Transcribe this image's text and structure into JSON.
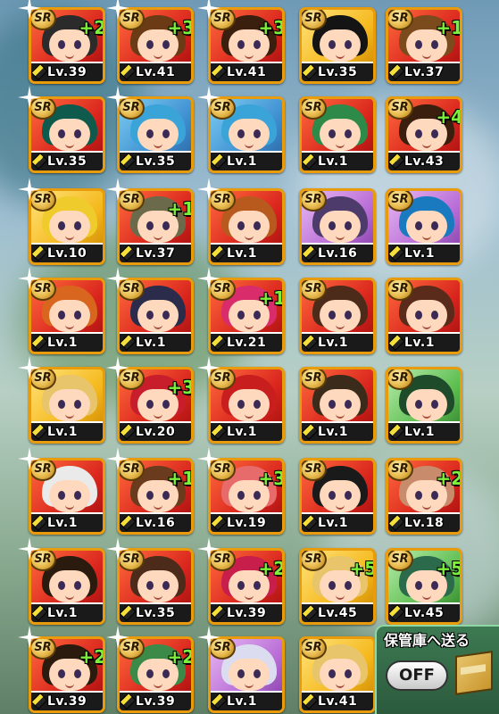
{
  "badge_text": "SR",
  "storage": {
    "label": "保管庫へ送る",
    "toggle": "OFF"
  },
  "cards": [
    {
      "lv": "Lv.39",
      "plus": "+2",
      "bg": "red",
      "hair": "#2b2b2b"
    },
    {
      "lv": "Lv.41",
      "plus": "+3",
      "bg": "red",
      "hair": "#6b3b16"
    },
    {
      "lv": "Lv.41",
      "plus": "+3",
      "bg": "red",
      "hair": "#3b1f0e"
    },
    {
      "lv": "Lv.35",
      "plus": "",
      "bg": "yellow",
      "hair": "#141414"
    },
    {
      "lv": "Lv.37",
      "plus": "+1",
      "bg": "red",
      "hair": "#7b4b1e"
    },
    {
      "lv": "Lv.35",
      "plus": "",
      "bg": "red",
      "hair": "#0e5a4c"
    },
    {
      "lv": "Lv.35",
      "plus": "",
      "bg": "blue",
      "hair": "#3aa4d8"
    },
    {
      "lv": "Lv.1",
      "plus": "",
      "bg": "blue",
      "hair": "#3aa4d8"
    },
    {
      "lv": "Lv.1",
      "plus": "",
      "bg": "red",
      "hair": "#2d8a48"
    },
    {
      "lv": "Lv.43",
      "plus": "+4",
      "bg": "red",
      "hair": "#3b1f0e"
    },
    {
      "lv": "Lv.10",
      "plus": "",
      "bg": "yellow",
      "hair": "#f0cb2c"
    },
    {
      "lv": "Lv.37",
      "plus": "+1",
      "bg": "red",
      "hair": "#6b6b4c"
    },
    {
      "lv": "Lv.1",
      "plus": "",
      "bg": "red",
      "hair": "#b85a1e"
    },
    {
      "lv": "Lv.16",
      "plus": "",
      "bg": "purple",
      "hair": "#4c3b6b"
    },
    {
      "lv": "Lv.1",
      "plus": "",
      "bg": "purple",
      "hair": "#1a7ac0"
    },
    {
      "lv": "Lv.1",
      "plus": "",
      "bg": "red",
      "hair": "#d8661e"
    },
    {
      "lv": "Lv.1",
      "plus": "",
      "bg": "red",
      "hair": "#2b2b4c"
    },
    {
      "lv": "Lv.21",
      "plus": "+1",
      "bg": "red",
      "hair": "#d82c6b"
    },
    {
      "lv": "Lv.1",
      "plus": "",
      "bg": "red",
      "hair": "#4c2b1a"
    },
    {
      "lv": "Lv.1",
      "plus": "",
      "bg": "red",
      "hair": "#5a2b1a"
    },
    {
      "lv": "Lv.1",
      "plus": "",
      "bg": "yellow",
      "hair": "#e8c46b"
    },
    {
      "lv": "Lv.20",
      "plus": "+3",
      "bg": "red",
      "hair": "#c81e2b"
    },
    {
      "lv": "Lv.1",
      "plus": "",
      "bg": "red",
      "hair": "#c81e1e"
    },
    {
      "lv": "Lv.1",
      "plus": "",
      "bg": "red",
      "hair": "#3b2b1a"
    },
    {
      "lv": "Lv.1",
      "plus": "",
      "bg": "green",
      "hair": "#1e4c2b"
    },
    {
      "lv": "Lv.1",
      "plus": "",
      "bg": "red",
      "hair": "#eaeaea"
    },
    {
      "lv": "Lv.16",
      "plus": "+1",
      "bg": "red",
      "hair": "#6b3b1e"
    },
    {
      "lv": "Lv.19",
      "plus": "+3",
      "bg": "red",
      "hair": "#e86b6b"
    },
    {
      "lv": "Lv.1",
      "plus": "",
      "bg": "red",
      "hair": "#1a1a1a"
    },
    {
      "lv": "Lv.18",
      "plus": "+2",
      "bg": "red",
      "hair": "#c88b6b"
    },
    {
      "lv": "Lv.1",
      "plus": "",
      "bg": "red",
      "hair": "#2b1a0e"
    },
    {
      "lv": "Lv.35",
      "plus": "",
      "bg": "red",
      "hair": "#4c2b1a"
    },
    {
      "lv": "Lv.39",
      "plus": "+2",
      "bg": "red",
      "hair": "#c81e4c"
    },
    {
      "lv": "Lv.45",
      "plus": "+5",
      "bg": "yellow",
      "hair": "#e8c46b"
    },
    {
      "lv": "Lv.45",
      "plus": "+5",
      "bg": "green",
      "hair": "#2b6b4c"
    },
    {
      "lv": "Lv.39",
      "plus": "+2",
      "bg": "red",
      "hair": "#2b1a0e"
    },
    {
      "lv": "Lv.39",
      "plus": "+2",
      "bg": "red",
      "hair": "#3b8a48"
    },
    {
      "lv": "Lv.1",
      "plus": "",
      "bg": "purple",
      "hair": "#dcdcf0"
    },
    {
      "lv": "Lv.41",
      "plus": "",
      "bg": "yellow",
      "hair": "#e8c46b"
    },
    {
      "lv": "",
      "plus": "",
      "bg": "green",
      "hair": "#3d7a52"
    }
  ]
}
